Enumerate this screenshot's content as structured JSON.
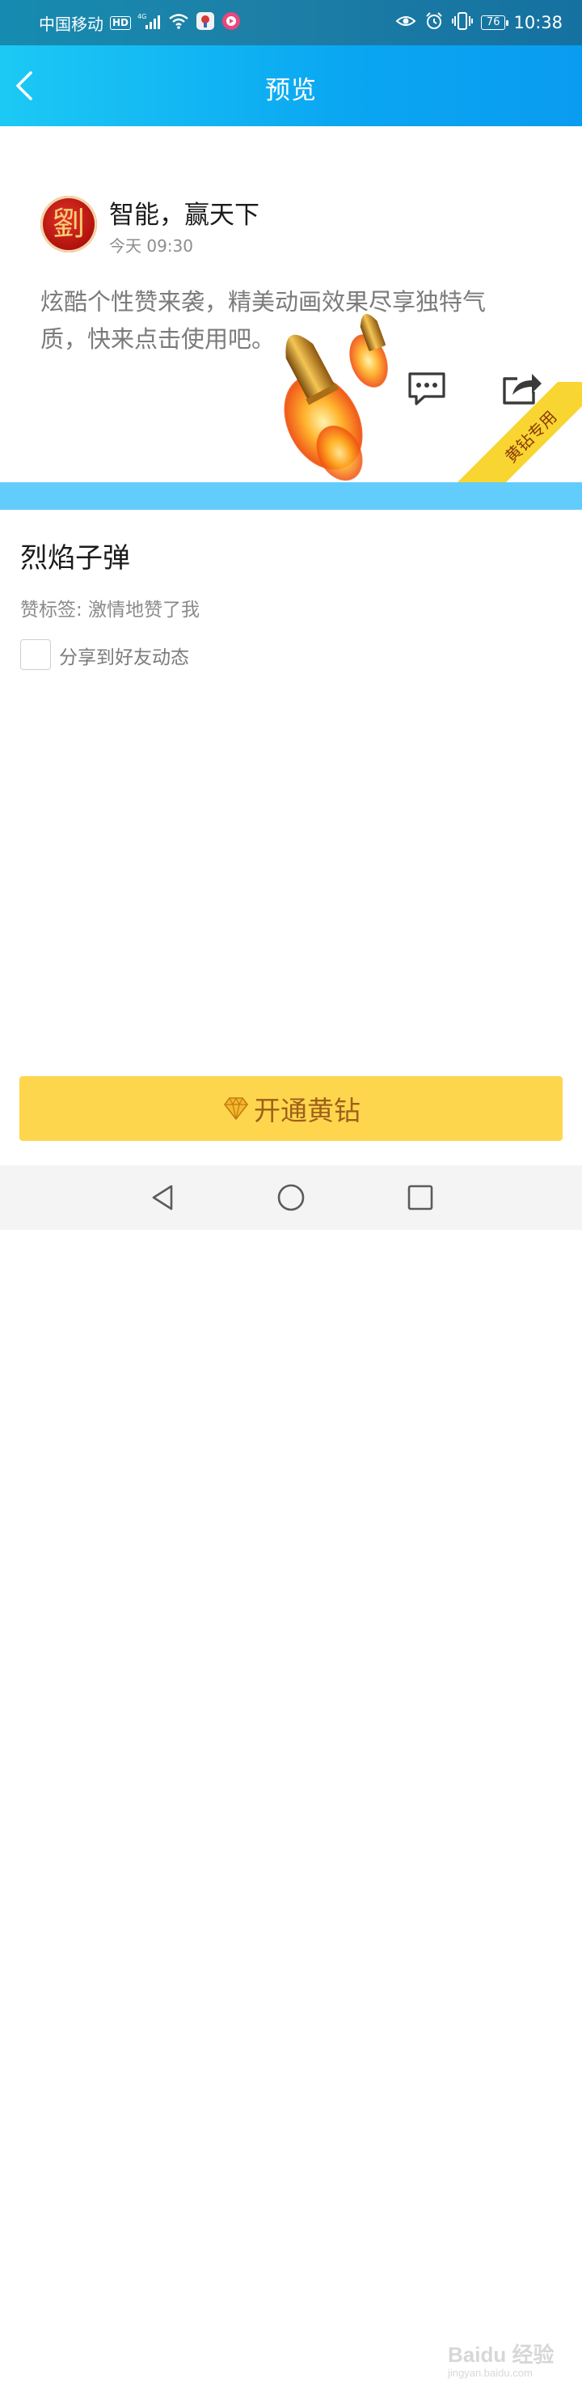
{
  "status_bar": {
    "carrier": "中国移动",
    "network_badge": "HD",
    "signal_label": "4G",
    "battery": "76",
    "time": "10:38",
    "icons": [
      "hd-icon",
      "signal-icon",
      "wifi-icon",
      "app-notification-icon",
      "video-notification-icon",
      "eye-comfort-icon",
      "alarm-icon",
      "vibrate-icon",
      "battery-icon"
    ]
  },
  "app_bar": {
    "title": "预览",
    "back_icon": "chevron-left-icon"
  },
  "preview": {
    "avatar_glyph": "劉",
    "author": "智能，赢天下",
    "time": "今天 09:30",
    "text": "炫酷个性赞来袭，精美动画效果尽享独特气质，快来点击使用吧。",
    "comment_icon": "comment-icon",
    "share_icon": "share-icon",
    "ribbon": "黄钻专用"
  },
  "effect": {
    "name": "烈焰子弹",
    "tag": "赞标签: 激情地赞了我",
    "share_checkbox_checked": false,
    "share_label": "分享到好友动态"
  },
  "cta": {
    "label": "开通黄钻",
    "icon": "diamond-icon"
  },
  "nav": {
    "back": "triangle-back-icon",
    "home": "circle-home-icon",
    "recent": "square-recent-icon"
  },
  "watermark": {
    "line1": "Baidu 经验",
    "line2": "jingyan.baidu.com"
  },
  "colors": {
    "app_bar_start": "#1cc9f4",
    "app_bar_end": "#0a9cf0",
    "divider": "#62cdfc",
    "cta_bg": "#fed64d",
    "cta_text": "#a05f1a",
    "ribbon": "#f8d531"
  }
}
